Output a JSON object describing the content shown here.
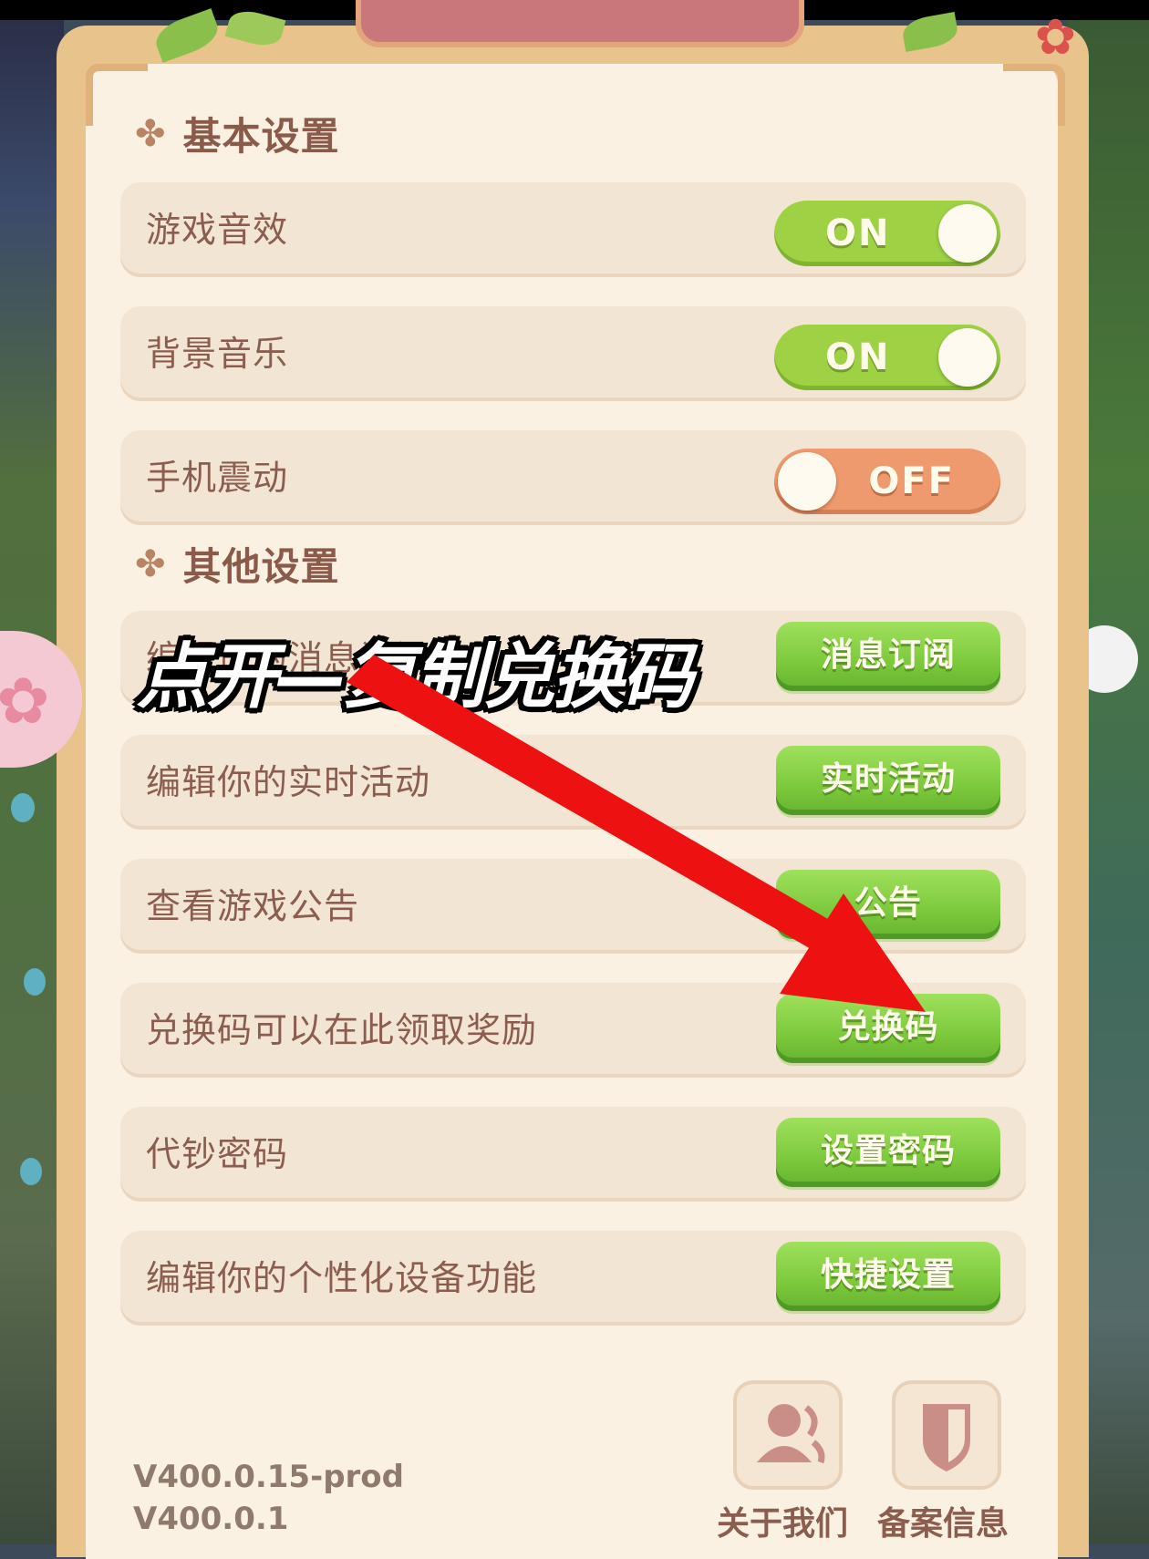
{
  "sections": {
    "basic": "基本设置",
    "other": "其他设置"
  },
  "toggles": [
    {
      "label": "游戏音效",
      "state_text": "ON"
    },
    {
      "label": "背景音乐",
      "state_text": "ON"
    },
    {
      "label": "手机震动",
      "state_text": "OFF"
    }
  ],
  "other_rows": [
    {
      "label": "编辑你的消息订阅",
      "button": "消息订阅"
    },
    {
      "label": "编辑你的实时活动",
      "button": "实时活动"
    },
    {
      "label": "查看游戏公告",
      "button": "公告"
    },
    {
      "label": "兑换码可以在此领取奖励",
      "button": "兑换码"
    },
    {
      "label": "代钞密码",
      "button": "设置密码"
    },
    {
      "label": "编辑你的个性化设备功能",
      "button": "快捷设置"
    }
  ],
  "overlay_caption": "点开—复制兑换码",
  "version": {
    "line1": "V400.0.15-prod",
    "line2": "V400.0.1"
  },
  "footer": {
    "about": "关于我们",
    "record": "备案信息"
  },
  "colors": {
    "panel": "#fbf1e2",
    "toggle_on": "#9ed244",
    "toggle_off": "#ee9a6e",
    "green_button": "#7cc93c",
    "arrow": "#ee1111"
  }
}
